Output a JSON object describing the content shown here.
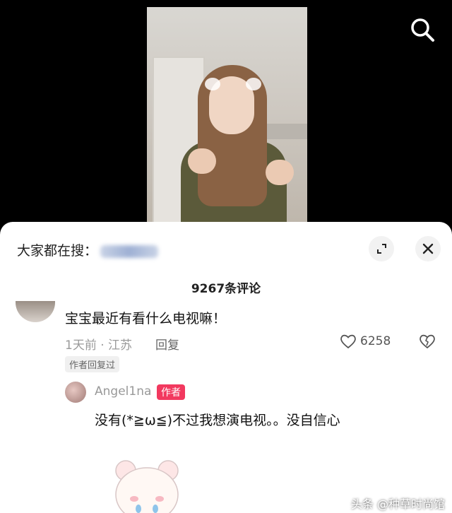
{
  "search_hint": {
    "label": "大家都在搜："
  },
  "header": {
    "comment_count": "9267条评论"
  },
  "comment": {
    "text": "宝宝最近有看什么电视嘛！",
    "meta": "1天前 · 江苏",
    "reply_label": "回复",
    "likes": "6258",
    "author_replied": "作者回复过"
  },
  "reply": {
    "username": "Angel1na",
    "badge": "作者",
    "text": "没有(*≧ω≦)不过我想演电视。。没自信心"
  },
  "watermark": "头条 @种草时尚馆",
  "colors": {
    "accent": "#f2395f",
    "sheet_bg": "#ffffff",
    "video_bg": "#000000"
  }
}
